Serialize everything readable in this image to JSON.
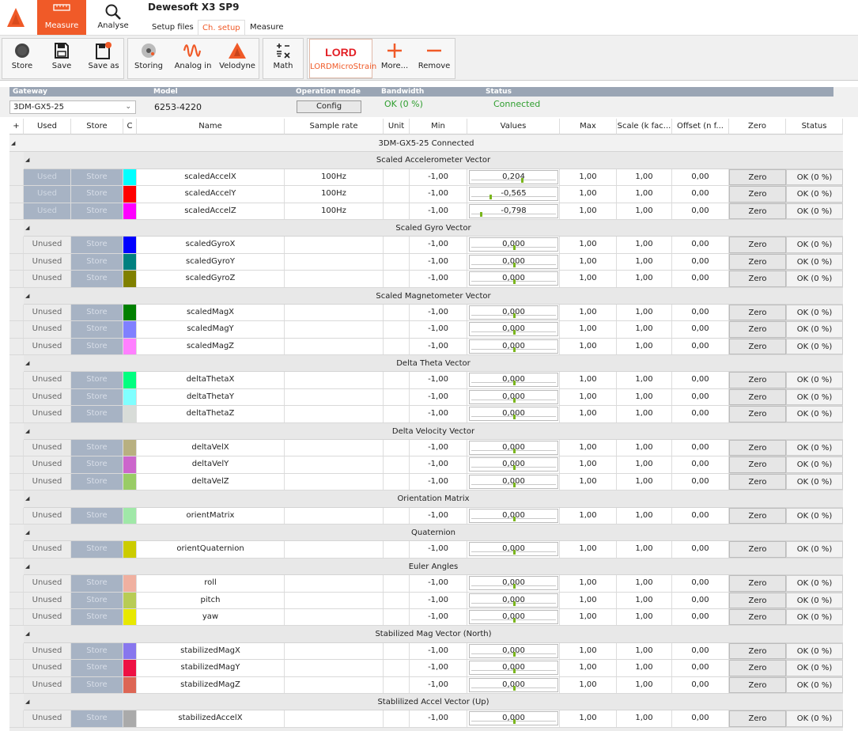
{
  "app": {
    "title": "Dewesoft X3 SP9"
  },
  "main_tabs": [
    {
      "label": "Measure"
    },
    {
      "label": "Analyse"
    }
  ],
  "sub_tabs": [
    {
      "label": "Setup files"
    },
    {
      "label": "Ch. setup"
    },
    {
      "label": "Measure"
    }
  ],
  "toolbar": [
    {
      "label": "Store",
      "icon": "record-icon"
    },
    {
      "label": "Save",
      "icon": "save-icon"
    },
    {
      "label": "Save as",
      "icon": "save-as-icon"
    },
    {
      "label": "Storing",
      "icon": "storing-icon"
    },
    {
      "label": "Analog in",
      "icon": "analog-wave-icon"
    },
    {
      "label": "Velodyne",
      "icon": "dewesoft-logo-icon"
    },
    {
      "label": "Math",
      "icon": "math-icon"
    },
    {
      "label": "LORDMicroStrain",
      "icon": "lord-logo-icon"
    },
    {
      "label": "More...",
      "icon": "plus-icon"
    },
    {
      "label": "Remove",
      "icon": "minus-icon"
    }
  ],
  "lord_logo_text": "LORD",
  "info": {
    "gateway_label": "Gateway",
    "gateway_value": "3DM-GX5-25",
    "model_label": "Model",
    "model_value": "6253-4220",
    "opmode_label": "Operation mode",
    "config_label": "Config",
    "bandwidth_label": "Bandwidth",
    "bandwidth_value": "OK (0 %)",
    "status_label": "Status",
    "status_value": "Connected"
  },
  "columns": [
    "+",
    "Used",
    "Store",
    "C",
    "Name",
    "Sample rate",
    "Unit",
    "Min",
    "Values",
    "Max",
    "Scale (k fac...",
    "Offset (n f...",
    "Zero",
    "Status"
  ],
  "device_label": "3DM-GX5-25 Connected",
  "groups": [
    {
      "name": "Scaled Accelerometer Vector",
      "channels": [
        {
          "used": "Used",
          "store": "Store",
          "color": "#00ffff",
          "name": "scaledAccelX",
          "rate": "100Hz",
          "unit": "",
          "min": "-1,00",
          "value": "0,204",
          "level": 0.602,
          "max": "1,00",
          "scale": "1,00",
          "offset": "0,00",
          "zero": "Zero",
          "status": "OK (0 %)"
        },
        {
          "used": "Used",
          "store": "Store",
          "color": "#ff0000",
          "name": "scaledAccelY",
          "rate": "100Hz",
          "unit": "",
          "min": "-1,00",
          "value": "-0,565",
          "level": 0.218,
          "max": "1,00",
          "scale": "1,00",
          "offset": "0,00",
          "zero": "Zero",
          "status": "OK (0 %)"
        },
        {
          "used": "Used",
          "store": "Store",
          "color": "#ff00ff",
          "name": "scaledAccelZ",
          "rate": "100Hz",
          "unit": "",
          "min": "-1,00",
          "value": "-0,798",
          "level": 0.101,
          "max": "1,00",
          "scale": "1,00",
          "offset": "0,00",
          "zero": "Zero",
          "status": "OK (0 %)"
        }
      ]
    },
    {
      "name": "Scaled Gyro Vector",
      "channels": [
        {
          "used": "Unused",
          "store": "Store",
          "color": "#0000ff",
          "name": "scaledGyroX",
          "rate": "",
          "unit": "",
          "min": "-1,00",
          "value": "0,000",
          "level": 0.5,
          "max": "1,00",
          "scale": "1,00",
          "offset": "0,00",
          "zero": "Zero",
          "status": "OK (0 %)"
        },
        {
          "used": "Unused",
          "store": "Store",
          "color": "#008080",
          "name": "scaledGyroY",
          "rate": "",
          "unit": "",
          "min": "-1,00",
          "value": "0,000",
          "level": 0.5,
          "max": "1,00",
          "scale": "1,00",
          "offset": "0,00",
          "zero": "Zero",
          "status": "OK (0 %)"
        },
        {
          "used": "Unused",
          "store": "Store",
          "color": "#808000",
          "name": "scaledGyroZ",
          "rate": "",
          "unit": "",
          "min": "-1,00",
          "value": "0,000",
          "level": 0.5,
          "max": "1,00",
          "scale": "1,00",
          "offset": "0,00",
          "zero": "Zero",
          "status": "OK (0 %)"
        }
      ]
    },
    {
      "name": "Scaled Magnetometer Vector",
      "channels": [
        {
          "used": "Unused",
          "store": "Store",
          "color": "#008000",
          "name": "scaledMagX",
          "rate": "",
          "unit": "",
          "min": "-1,00",
          "value": "0,000",
          "level": 0.5,
          "max": "1,00",
          "scale": "1,00",
          "offset": "0,00",
          "zero": "Zero",
          "status": "OK (0 %)"
        },
        {
          "used": "Unused",
          "store": "Store",
          "color": "#8080ff",
          "name": "scaledMagY",
          "rate": "",
          "unit": "",
          "min": "-1,00",
          "value": "0,000",
          "level": 0.5,
          "max": "1,00",
          "scale": "1,00",
          "offset": "0,00",
          "zero": "Zero",
          "status": "OK (0 %)"
        },
        {
          "used": "Unused",
          "store": "Store",
          "color": "#ff80ff",
          "name": "scaledMagZ",
          "rate": "",
          "unit": "",
          "min": "-1,00",
          "value": "0,000",
          "level": 0.5,
          "max": "1,00",
          "scale": "1,00",
          "offset": "0,00",
          "zero": "Zero",
          "status": "OK (0 %)"
        }
      ]
    },
    {
      "name": "Delta Theta Vector",
      "channels": [
        {
          "used": "Unused",
          "store": "Store",
          "color": "#00ff80",
          "name": "deltaThetaX",
          "rate": "",
          "unit": "",
          "min": "-1,00",
          "value": "0,000",
          "level": 0.5,
          "max": "1,00",
          "scale": "1,00",
          "offset": "0,00",
          "zero": "Zero",
          "status": "OK (0 %)"
        },
        {
          "used": "Unused",
          "store": "Store",
          "color": "#80ffff",
          "name": "deltaThetaY",
          "rate": "",
          "unit": "",
          "min": "-1,00",
          "value": "0,000",
          "level": 0.5,
          "max": "1,00",
          "scale": "1,00",
          "offset": "0,00",
          "zero": "Zero",
          "status": "OK (0 %)"
        },
        {
          "used": "Unused",
          "store": "Store",
          "color": "#d8dcd8",
          "name": "deltaThetaZ",
          "rate": "",
          "unit": "",
          "min": "-1,00",
          "value": "0,000",
          "level": 0.5,
          "max": "1,00",
          "scale": "1,00",
          "offset": "0,00",
          "zero": "Zero",
          "status": "OK (0 %)"
        }
      ]
    },
    {
      "name": "Delta Velocity Vector",
      "channels": [
        {
          "used": "Unused",
          "store": "Store",
          "color": "#b8b080",
          "name": "deltaVelX",
          "rate": "",
          "unit": "",
          "min": "-1,00",
          "value": "0,000",
          "level": 0.5,
          "max": "1,00",
          "scale": "1,00",
          "offset": "0,00",
          "zero": "Zero",
          "status": "OK (0 %)"
        },
        {
          "used": "Unused",
          "store": "Store",
          "color": "#cc66cc",
          "name": "deltaVelY",
          "rate": "",
          "unit": "",
          "min": "-1,00",
          "value": "0,000",
          "level": 0.5,
          "max": "1,00",
          "scale": "1,00",
          "offset": "0,00",
          "zero": "Zero",
          "status": "OK (0 %)"
        },
        {
          "used": "Unused",
          "store": "Store",
          "color": "#99cc66",
          "name": "deltaVelZ",
          "rate": "",
          "unit": "",
          "min": "-1,00",
          "value": "0,000",
          "level": 0.5,
          "max": "1,00",
          "scale": "1,00",
          "offset": "0,00",
          "zero": "Zero",
          "status": "OK (0 %)"
        }
      ]
    },
    {
      "name": "Orientation Matrix",
      "channels": [
        {
          "used": "Unused",
          "store": "Store",
          "color": "#a0e8a8",
          "name": "orientMatrix",
          "rate": "",
          "unit": "",
          "min": "-1,00",
          "value": "0,000",
          "level": 0.5,
          "max": "1,00",
          "scale": "1,00",
          "offset": "0,00",
          "zero": "Zero",
          "status": "OK (0 %)"
        }
      ]
    },
    {
      "name": "Quaternion",
      "channels": [
        {
          "used": "Unused",
          "store": "Store",
          "color": "#cccc00",
          "name": "orientQuaternion",
          "rate": "",
          "unit": "",
          "min": "-1,00",
          "value": "0,000",
          "level": 0.5,
          "max": "1,00",
          "scale": "1,00",
          "offset": "0,00",
          "zero": "Zero",
          "status": "OK (0 %)"
        }
      ]
    },
    {
      "name": "Euler Angles",
      "channels": [
        {
          "used": "Unused",
          "store": "Store",
          "color": "#f0b0a0",
          "name": "roll",
          "rate": "",
          "unit": "",
          "min": "-1,00",
          "value": "0,000",
          "level": 0.5,
          "max": "1,00",
          "scale": "1,00",
          "offset": "0,00",
          "zero": "Zero",
          "status": "OK (0 %)"
        },
        {
          "used": "Unused",
          "store": "Store",
          "color": "#b8cc55",
          "name": "pitch",
          "rate": "",
          "unit": "",
          "min": "-1,00",
          "value": "0,000",
          "level": 0.5,
          "max": "1,00",
          "scale": "1,00",
          "offset": "0,00",
          "zero": "Zero",
          "status": "OK (0 %)"
        },
        {
          "used": "Unused",
          "store": "Store",
          "color": "#e8e800",
          "name": "yaw",
          "rate": "",
          "unit": "",
          "min": "-1,00",
          "value": "0,000",
          "level": 0.5,
          "max": "1,00",
          "scale": "1,00",
          "offset": "0,00",
          "zero": "Zero",
          "status": "OK (0 %)"
        }
      ]
    },
    {
      "name": "Stabilized Mag Vector (North)",
      "channels": [
        {
          "used": "Unused",
          "store": "Store",
          "color": "#8877ee",
          "name": "stabilizedMagX",
          "rate": "",
          "unit": "",
          "min": "-1,00",
          "value": "0,000",
          "level": 0.5,
          "max": "1,00",
          "scale": "1,00",
          "offset": "0,00",
          "zero": "Zero",
          "status": "OK (0 %)"
        },
        {
          "used": "Unused",
          "store": "Store",
          "color": "#ee1144",
          "name": "stabilizedMagY",
          "rate": "",
          "unit": "",
          "min": "-1,00",
          "value": "0,000",
          "level": 0.5,
          "max": "1,00",
          "scale": "1,00",
          "offset": "0,00",
          "zero": "Zero",
          "status": "OK (0 %)"
        },
        {
          "used": "Unused",
          "store": "Store",
          "color": "#dd6655",
          "name": "stabilizedMagZ",
          "rate": "",
          "unit": "",
          "min": "-1,00",
          "value": "0,000",
          "level": 0.5,
          "max": "1,00",
          "scale": "1,00",
          "offset": "0,00",
          "zero": "Zero",
          "status": "OK (0 %)"
        }
      ]
    },
    {
      "name": "Stablilized Accel Vector (Up)",
      "channels": [
        {
          "used": "Unused",
          "store": "Store",
          "color": "#aaaaaa",
          "name": "stabilizedAccelX",
          "rate": "",
          "unit": "",
          "min": "-1,00",
          "value": "0,000",
          "level": 0.5,
          "max": "1,00",
          "scale": "1,00",
          "offset": "0,00",
          "zero": "Zero",
          "status": "OK (0 %)"
        }
      ]
    }
  ],
  "colors": {
    "accent": "#f05a28",
    "ok_green": "#2e9e2e",
    "store_blue": "#a7b3c4"
  }
}
